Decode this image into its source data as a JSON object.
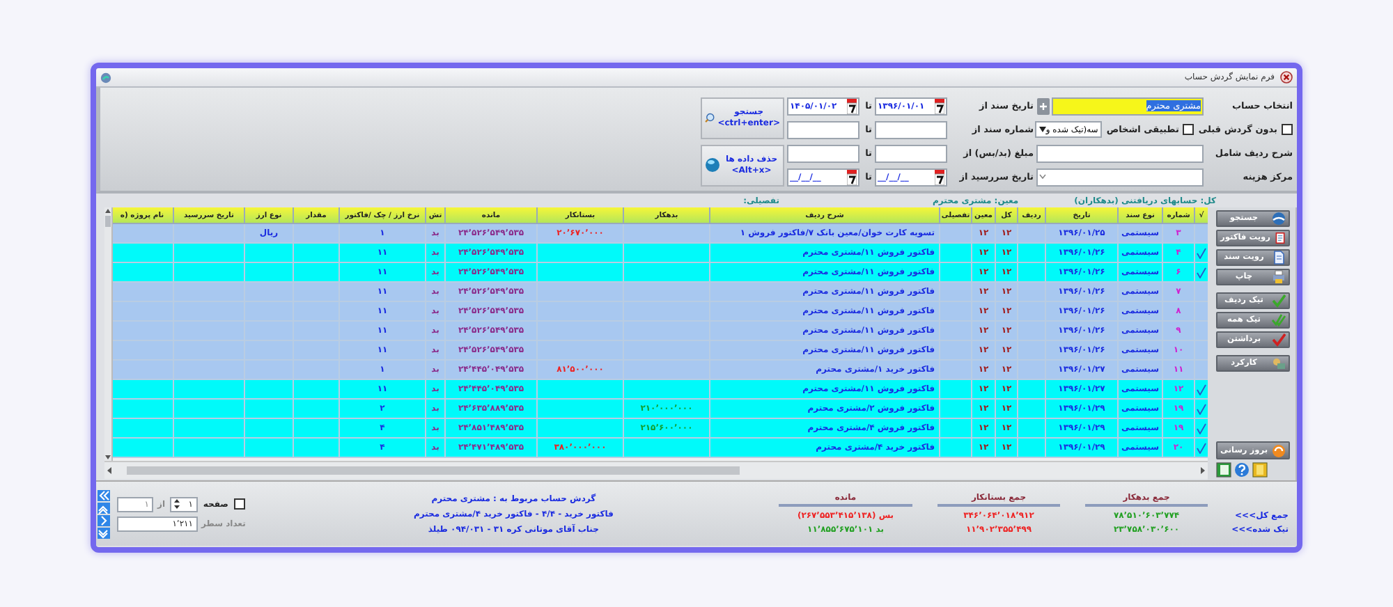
{
  "window": {
    "title": "فرم نمایش گردش حساب"
  },
  "filters": {
    "account": {
      "label": "انتخاب حساب",
      "value": "مشتری محترم"
    },
    "no_prior_turnover": {
      "label": "بدون گردش قبلی",
      "checked": false
    },
    "match_persons": {
      "label": "تطبیقی اشخاص",
      "checked": false
    },
    "mode": {
      "value": "سه(تیک شده و"
    },
    "row_description": {
      "label": "شرح ردیف شامل"
    },
    "cost_center": {
      "label": "مرکز هزینه"
    },
    "doc_date": {
      "label": "تاریخ سند از",
      "from": "۱۳۹۶/۰۱/۰۱",
      "to_label": "تا",
      "to": "۱۴۰۵/۰۱/۰۲"
    },
    "doc_number": {
      "label": "شماره سند از",
      "to_label": "تا"
    },
    "amount": {
      "label": "مبلغ (بد/بس) از",
      "to_label": "تا"
    },
    "due_date": {
      "label": "تاریخ سررسید از",
      "from": "__/__/__",
      "to_label": "تا",
      "to": "__/__/__"
    }
  },
  "search_button": {
    "label": "جستجو",
    "shortcut": "<ctrl+enter>"
  },
  "clear_button": {
    "label": "حذف داده ها",
    "shortcut": "<Alt+x>"
  },
  "breadcrumb": [
    "کل: حسابهای دریافتنی (بدهکاران)",
    "معین: مشتری محترم",
    "تفصیلی:"
  ],
  "table": {
    "columns": [
      "√",
      "شماره",
      "نوع سند",
      "تاریخ",
      "ردیف",
      "کل",
      "معین",
      "تفصیلی",
      "شرح ردیف",
      "بدهکار",
      "بستانکار",
      "مانده",
      "تش",
      "نرخ ارز / چک /فاکتور",
      "مقدار",
      "نوع ارز",
      "تاریخ سررسید",
      "نام پروژه (ه"
    ],
    "rows": [
      {
        "checked": false,
        "number": "۳",
        "doc_type": "سیستمی",
        "date": "۱۳۹۶/۰۱/۲۵",
        "ledger": "۱۲",
        "subledger": "۱۲",
        "description": "تسویه کارت خوان/معین بانک ۷/فاکتور فروش ۱",
        "credit": "۲۰٬۶۷۰٬۰۰۰",
        "balance": "۲۴٬۵۲۶٬۵۴۹٬۵۳۵",
        "nature": "بد",
        "rate": "۱",
        "currency": "ریال"
      },
      {
        "checked": true,
        "number": "۴",
        "doc_type": "سیستمی",
        "date": "۱۳۹۶/۰۱/۲۶",
        "ledger": "۱۲",
        "subledger": "۱۲",
        "description": "فاکتور فروش ۱۱/مشتری محترم",
        "balance": "۲۴٬۵۲۶٬۵۴۹٬۵۳۵",
        "nature": "بد",
        "rate": "۱۱"
      },
      {
        "checked": true,
        "number": "۶",
        "doc_type": "سیستمی",
        "date": "۱۳۹۶/۰۱/۲۶",
        "ledger": "۱۲",
        "subledger": "۱۲",
        "description": "فاکتور فروش ۱۱/مشتری محترم",
        "balance": "۲۴٬۵۲۶٬۵۴۹٬۵۳۵",
        "nature": "بد",
        "rate": "۱۱"
      },
      {
        "checked": false,
        "number": "۷",
        "doc_type": "سیستمی",
        "date": "۱۳۹۶/۰۱/۲۶",
        "ledger": "۱۲",
        "subledger": "۱۲",
        "description": "فاکتور فروش ۱۱/مشتری محترم",
        "balance": "۲۴٬۵۲۶٬۵۴۹٬۵۳۵",
        "nature": "بد",
        "rate": "۱۱"
      },
      {
        "checked": false,
        "number": "۸",
        "doc_type": "سیستمی",
        "date": "۱۳۹۶/۰۱/۲۶",
        "ledger": "۱۲",
        "subledger": "۱۲",
        "description": "فاکتور فروش ۱۱/مشتری محترم",
        "balance": "۲۴٬۵۲۶٬۵۴۹٬۵۳۵",
        "nature": "بد",
        "rate": "۱۱"
      },
      {
        "checked": false,
        "number": "۹",
        "doc_type": "سیستمی",
        "date": "۱۳۹۶/۰۱/۲۶",
        "ledger": "۱۲",
        "subledger": "۱۲",
        "description": "فاکتور فروش ۱۱/مشتری محترم",
        "balance": "۲۴٬۵۲۶٬۵۴۹٬۵۳۵",
        "nature": "بد",
        "rate": "۱۱"
      },
      {
        "checked": false,
        "number": "۱۰",
        "doc_type": "سیستمی",
        "date": "۱۳۹۶/۰۱/۲۶",
        "ledger": "۱۲",
        "subledger": "۱۲",
        "description": "فاکتور فروش ۱۱/مشتری محترم",
        "balance": "۲۴٬۵۲۶٬۵۴۹٬۵۳۵",
        "nature": "بد",
        "rate": "۱۱"
      },
      {
        "checked": false,
        "number": "۱۱",
        "doc_type": "سیستمی",
        "date": "۱۳۹۶/۰۱/۲۷",
        "ledger": "۱۲",
        "subledger": "۱۲",
        "description": "فاکتور خرید ۱/مشتری محترم",
        "credit": "۸۱٬۵۰۰٬۰۰۰",
        "balance": "۲۴٬۴۴۵٬۰۴۹٬۵۳۵",
        "nature": "بد",
        "rate": "۱"
      },
      {
        "checked": true,
        "number": "۱۲",
        "doc_type": "سیستمی",
        "date": "۱۳۹۶/۰۱/۲۷",
        "ledger": "۱۲",
        "subledger": "۱۲",
        "description": "فاکتور فروش ۱۱/مشتری محترم",
        "balance": "۲۴٬۴۴۵٬۰۴۹٬۵۳۵",
        "nature": "بد",
        "rate": "۱۱"
      },
      {
        "checked": true,
        "number": "۱۹",
        "doc_type": "سیستمی",
        "date": "۱۳۹۶/۰۱/۲۹",
        "ledger": "۱۲",
        "subledger": "۱۲",
        "description": "فاکتور فروش ۲/مشتری محترم",
        "debit": "۲۱۰٬۰۰۰٬۰۰۰",
        "balance": "۲۴٬۶۳۵٬۸۸۹٬۵۳۵",
        "nature": "بد",
        "rate": "۲"
      },
      {
        "checked": true,
        "number": "۱۹",
        "doc_type": "سیستمی",
        "date": "۱۳۹۶/۰۱/۲۹",
        "ledger": "۱۲",
        "subledger": "۱۲",
        "description": "فاکتور فروش ۴/مشتری محترم",
        "debit": "۲۱۵٬۶۰۰٬۰۰۰",
        "balance": "۲۴٬۸۵۱٬۴۸۹٬۵۳۵",
        "nature": "بد",
        "rate": "۴"
      },
      {
        "checked": true,
        "number": "۲۰",
        "doc_type": "سیستمی",
        "date": "۱۳۹۶/۰۱/۲۹",
        "ledger": "۱۲",
        "subledger": "۱۲",
        "description": "فاکتور خرید ۴/مشتری محترم",
        "credit": "۳۸۰٬۰۰۰٬۰۰۰",
        "balance": "۲۴٬۴۷۱٬۴۸۹٬۵۳۵",
        "nature": "بد",
        "rate": "۴"
      }
    ]
  },
  "toolbar": [
    [
      {
        "label": "جستجو"
      },
      {
        "label": "رویت فاکتور"
      },
      {
        "label": "رویت سند"
      },
      {
        "label": "چاپ"
      }
    ],
    [
      {
        "label": "تیک ردیف"
      },
      {
        "label": "تیک همه"
      },
      {
        "label": "برداشتن"
      }
    ],
    [
      {
        "label": "کارکرد"
      }
    ]
  ],
  "refresh_button": {
    "label": "بروز رسانی"
  },
  "pager": {
    "checked": false,
    "label": "صفحه",
    "page": "۱",
    "of_label": "از",
    "pages": "۱",
    "rows_label": "تعداد سطر",
    "rows": "۱٬۲۱۱"
  },
  "status_lines": [
    "گردش حساب مربوط به : مشتری محترم",
    "فاکتور خرید - ۴/۴ - فاکتور خرید ۴/مشتری محترم",
    "جناب آقای موتانی کره ۳۱ - ۰۹۴/۰۳۱ طیلذ"
  ],
  "totals": {
    "columns": [
      "جمع بدهکار",
      "جمع بستانکار",
      "مانده"
    ],
    "rows": [
      {
        "label": "جمع کل>>>",
        "debit": "۷۸٬۵۱۰٬۶۰۳٬۷۷۴",
        "credit": "۳۴۶٬۰۶۴٬۰۱۸٬۹۱۲",
        "balance": "بس (۲۶۷٬۵۵۳٬۴۱۵٬۱۳۸)",
        "color": "#ee2222"
      },
      {
        "label": "تیک شده>>>",
        "debit": "۲۳٬۷۵۸٬۰۳۰٬۶۰۰",
        "credit": "۱۱٬۹۰۲٬۳۵۵٬۴۹۹",
        "balance": "بد ۱۱٬۸۵۵٬۶۷۵٬۱۰۱",
        "color": "#22a022"
      }
    ]
  }
}
